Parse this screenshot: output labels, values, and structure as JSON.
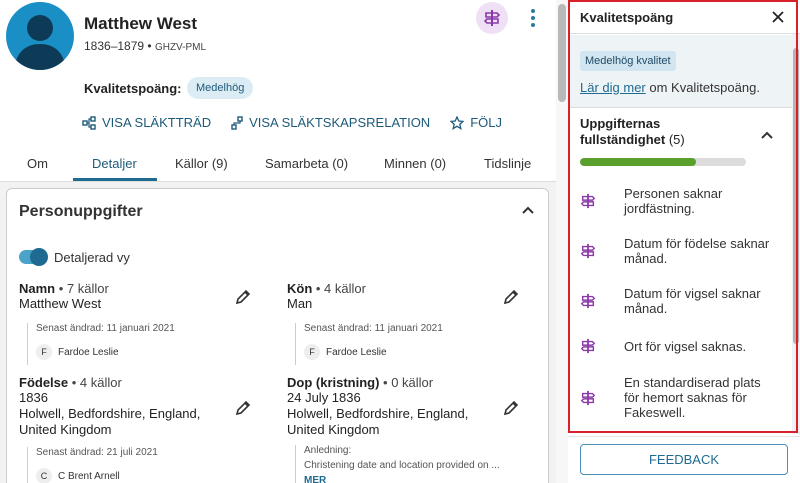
{
  "person": {
    "name": "Matthew West",
    "lifespan": "1836–1879",
    "separator": " • ",
    "pid": "GHZV-PML",
    "quality_label": "Kvalitetspoäng:",
    "quality_badge": "Medelhög"
  },
  "actions": [
    {
      "label": "VISA SLÄKTTRÄD",
      "icon": "tree-icon"
    },
    {
      "label": "VISA SLÄKTSKAPSRELATION",
      "icon": "relationship-icon"
    },
    {
      "label": "FÖLJ",
      "icon": "star-icon"
    }
  ],
  "tabs": [
    {
      "label": "Om"
    },
    {
      "label": "Detaljer",
      "active": true
    },
    {
      "label": "Källor (9)"
    },
    {
      "label": "Samarbeta (0)"
    },
    {
      "label": "Minnen (0)"
    },
    {
      "label": "Tidslinje"
    }
  ],
  "card": {
    "title": "Personuppgifter",
    "toggle_label": "Detaljerad vy",
    "toggle_on": true
  },
  "fields": {
    "name": {
      "title": "Namn",
      "sources": " • 7 källor",
      "value": "Matthew West",
      "changed": "Senast ändrad: 11 januari 2021",
      "initial": "F",
      "contributor": "Fardoe Leslie"
    },
    "sex": {
      "title": "Kön",
      "sources": " • 4 källor",
      "value": "Man",
      "changed": "Senast ändrad: 11 januari 2021",
      "initial": "F",
      "contributor": "Fardoe Leslie"
    },
    "birth": {
      "title": "Födelse",
      "sources": " • 4 källor",
      "date": "1836",
      "place1": "Holwell, Bedfordshire, England,",
      "place2": "United Kingdom",
      "changed": "Senast ändrad: 21 juli 2021",
      "initial": "C",
      "contributor": "C Brent Arnell"
    },
    "christening": {
      "title": "Dop (kristning)",
      "sources": " • 0 källor",
      "date": "24 July 1836",
      "place1": "Holwell, Bedfordshire, England,",
      "place2": "United Kingdom",
      "reason_label": "Anledning:",
      "reason": "Christening date and location provided on ...",
      "more": "MER"
    }
  },
  "panel": {
    "title": "Kvalitetspoäng",
    "badge": "Medelhög kvalitet",
    "learn_link": "Lär dig mer",
    "learn_rest": " om Kvalitetspoäng.",
    "completeness_title": "Uppgifternas fullständighet",
    "completeness_count": " (5)",
    "progress": 0.7,
    "issues": [
      {
        "line1": "Personen saknar",
        "line2": "jordfästning."
      },
      {
        "line1": "Datum för födelse saknar",
        "line2": "månad."
      },
      {
        "line1": "Datum för vigsel saknar",
        "line2": "månad."
      },
      {
        "line1": "Ort för vigsel saknas.",
        "line2": ""
      },
      {
        "line1": "En standardiserad plats",
        "line2": "för hemort saknas för",
        "line3": "Fakeswell."
      }
    ],
    "feedback": "FEEDBACK"
  },
  "colors": {
    "accent": "#1e6a90",
    "avatar": "#1a8fc6",
    "issue_icon": "#8a3aa8",
    "progress": "#5aa02c",
    "highlight_border": "#d8202a"
  }
}
